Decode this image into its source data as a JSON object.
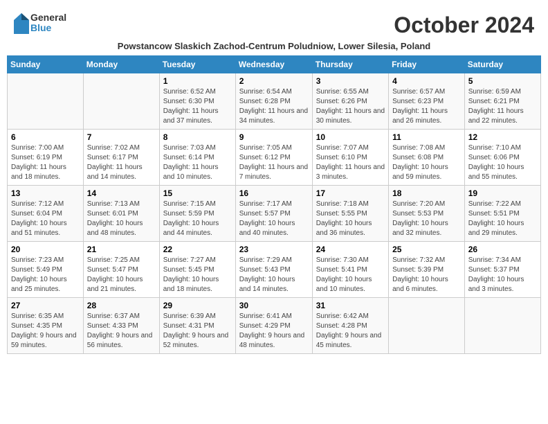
{
  "header": {
    "logo_line1": "General",
    "logo_line2": "Blue",
    "month_title": "October 2024",
    "subtitle": "Powstancow Slaskich Zachod-Centrum Poludniow, Lower Silesia, Poland"
  },
  "weekdays": [
    "Sunday",
    "Monday",
    "Tuesday",
    "Wednesday",
    "Thursday",
    "Friday",
    "Saturday"
  ],
  "weeks": [
    [
      {
        "day": "",
        "sunrise": "",
        "sunset": "",
        "daylight": ""
      },
      {
        "day": "",
        "sunrise": "",
        "sunset": "",
        "daylight": ""
      },
      {
        "day": "1",
        "sunrise": "Sunrise: 6:52 AM",
        "sunset": "Sunset: 6:30 PM",
        "daylight": "Daylight: 11 hours and 37 minutes."
      },
      {
        "day": "2",
        "sunrise": "Sunrise: 6:54 AM",
        "sunset": "Sunset: 6:28 PM",
        "daylight": "Daylight: 11 hours and 34 minutes."
      },
      {
        "day": "3",
        "sunrise": "Sunrise: 6:55 AM",
        "sunset": "Sunset: 6:26 PM",
        "daylight": "Daylight: 11 hours and 30 minutes."
      },
      {
        "day": "4",
        "sunrise": "Sunrise: 6:57 AM",
        "sunset": "Sunset: 6:23 PM",
        "daylight": "Daylight: 11 hours and 26 minutes."
      },
      {
        "day": "5",
        "sunrise": "Sunrise: 6:59 AM",
        "sunset": "Sunset: 6:21 PM",
        "daylight": "Daylight: 11 hours and 22 minutes."
      }
    ],
    [
      {
        "day": "6",
        "sunrise": "Sunrise: 7:00 AM",
        "sunset": "Sunset: 6:19 PM",
        "daylight": "Daylight: 11 hours and 18 minutes."
      },
      {
        "day": "7",
        "sunrise": "Sunrise: 7:02 AM",
        "sunset": "Sunset: 6:17 PM",
        "daylight": "Daylight: 11 hours and 14 minutes."
      },
      {
        "day": "8",
        "sunrise": "Sunrise: 7:03 AM",
        "sunset": "Sunset: 6:14 PM",
        "daylight": "Daylight: 11 hours and 10 minutes."
      },
      {
        "day": "9",
        "sunrise": "Sunrise: 7:05 AM",
        "sunset": "Sunset: 6:12 PM",
        "daylight": "Daylight: 11 hours and 7 minutes."
      },
      {
        "day": "10",
        "sunrise": "Sunrise: 7:07 AM",
        "sunset": "Sunset: 6:10 PM",
        "daylight": "Daylight: 11 hours and 3 minutes."
      },
      {
        "day": "11",
        "sunrise": "Sunrise: 7:08 AM",
        "sunset": "Sunset: 6:08 PM",
        "daylight": "Daylight: 10 hours and 59 minutes."
      },
      {
        "day": "12",
        "sunrise": "Sunrise: 7:10 AM",
        "sunset": "Sunset: 6:06 PM",
        "daylight": "Daylight: 10 hours and 55 minutes."
      }
    ],
    [
      {
        "day": "13",
        "sunrise": "Sunrise: 7:12 AM",
        "sunset": "Sunset: 6:04 PM",
        "daylight": "Daylight: 10 hours and 51 minutes."
      },
      {
        "day": "14",
        "sunrise": "Sunrise: 7:13 AM",
        "sunset": "Sunset: 6:01 PM",
        "daylight": "Daylight: 10 hours and 48 minutes."
      },
      {
        "day": "15",
        "sunrise": "Sunrise: 7:15 AM",
        "sunset": "Sunset: 5:59 PM",
        "daylight": "Daylight: 10 hours and 44 minutes."
      },
      {
        "day": "16",
        "sunrise": "Sunrise: 7:17 AM",
        "sunset": "Sunset: 5:57 PM",
        "daylight": "Daylight: 10 hours and 40 minutes."
      },
      {
        "day": "17",
        "sunrise": "Sunrise: 7:18 AM",
        "sunset": "Sunset: 5:55 PM",
        "daylight": "Daylight: 10 hours and 36 minutes."
      },
      {
        "day": "18",
        "sunrise": "Sunrise: 7:20 AM",
        "sunset": "Sunset: 5:53 PM",
        "daylight": "Daylight: 10 hours and 32 minutes."
      },
      {
        "day": "19",
        "sunrise": "Sunrise: 7:22 AM",
        "sunset": "Sunset: 5:51 PM",
        "daylight": "Daylight: 10 hours and 29 minutes."
      }
    ],
    [
      {
        "day": "20",
        "sunrise": "Sunrise: 7:23 AM",
        "sunset": "Sunset: 5:49 PM",
        "daylight": "Daylight: 10 hours and 25 minutes."
      },
      {
        "day": "21",
        "sunrise": "Sunrise: 7:25 AM",
        "sunset": "Sunset: 5:47 PM",
        "daylight": "Daylight: 10 hours and 21 minutes."
      },
      {
        "day": "22",
        "sunrise": "Sunrise: 7:27 AM",
        "sunset": "Sunset: 5:45 PM",
        "daylight": "Daylight: 10 hours and 18 minutes."
      },
      {
        "day": "23",
        "sunrise": "Sunrise: 7:29 AM",
        "sunset": "Sunset: 5:43 PM",
        "daylight": "Daylight: 10 hours and 14 minutes."
      },
      {
        "day": "24",
        "sunrise": "Sunrise: 7:30 AM",
        "sunset": "Sunset: 5:41 PM",
        "daylight": "Daylight: 10 hours and 10 minutes."
      },
      {
        "day": "25",
        "sunrise": "Sunrise: 7:32 AM",
        "sunset": "Sunset: 5:39 PM",
        "daylight": "Daylight: 10 hours and 6 minutes."
      },
      {
        "day": "26",
        "sunrise": "Sunrise: 7:34 AM",
        "sunset": "Sunset: 5:37 PM",
        "daylight": "Daylight: 10 hours and 3 minutes."
      }
    ],
    [
      {
        "day": "27",
        "sunrise": "Sunrise: 6:35 AM",
        "sunset": "Sunset: 4:35 PM",
        "daylight": "Daylight: 9 hours and 59 minutes."
      },
      {
        "day": "28",
        "sunrise": "Sunrise: 6:37 AM",
        "sunset": "Sunset: 4:33 PM",
        "daylight": "Daylight: 9 hours and 56 minutes."
      },
      {
        "day": "29",
        "sunrise": "Sunrise: 6:39 AM",
        "sunset": "Sunset: 4:31 PM",
        "daylight": "Daylight: 9 hours and 52 minutes."
      },
      {
        "day": "30",
        "sunrise": "Sunrise: 6:41 AM",
        "sunset": "Sunset: 4:29 PM",
        "daylight": "Daylight: 9 hours and 48 minutes."
      },
      {
        "day": "31",
        "sunrise": "Sunrise: 6:42 AM",
        "sunset": "Sunset: 4:28 PM",
        "daylight": "Daylight: 9 hours and 45 minutes."
      },
      {
        "day": "",
        "sunrise": "",
        "sunset": "",
        "daylight": ""
      },
      {
        "day": "",
        "sunrise": "",
        "sunset": "",
        "daylight": ""
      }
    ]
  ]
}
